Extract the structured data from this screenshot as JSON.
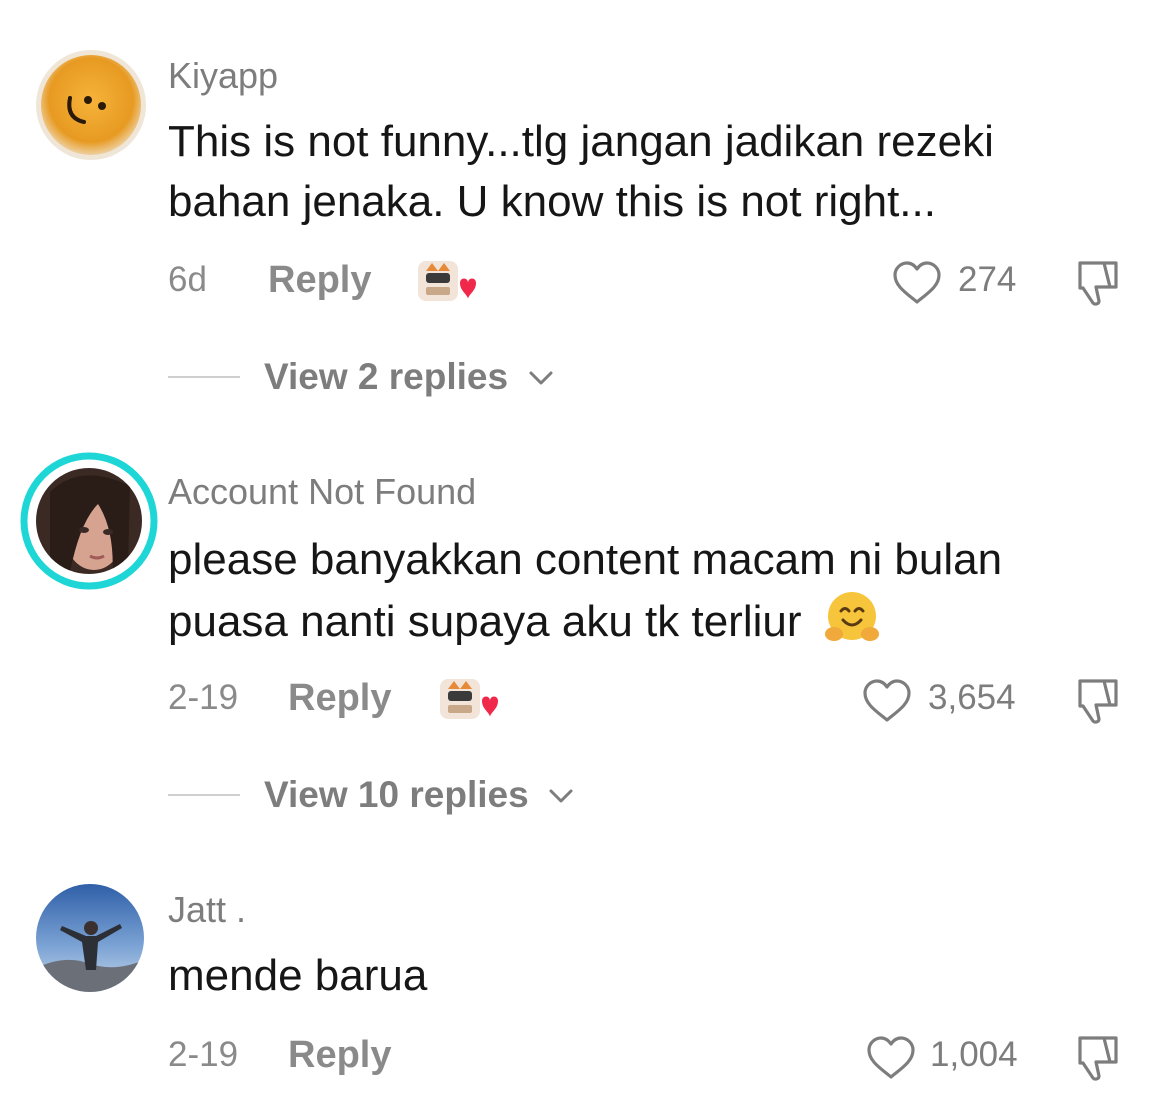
{
  "comments": [
    {
      "username": "Kiyapp",
      "text": "This is not funny...tlg jangan jadikan rezeki bahan jenaka. U know this is not right...",
      "time": "6d",
      "reply_label": "Reply",
      "likes": "274",
      "view_replies": "View 2 replies"
    },
    {
      "username": "Account Not Found",
      "text": "please banyakkan content macam ni bulan puasa nanti supaya aku tk terliur",
      "time": "2-19",
      "reply_label": "Reply",
      "likes": "3,654",
      "view_replies": "View 10 replies",
      "emoji": "hugging-face-emoji"
    },
    {
      "username": "Jatt .",
      "text": "mende barua",
      "time": "2-19",
      "reply_label": "Reply",
      "likes": "1,004"
    }
  ],
  "colors": {
    "text": "#161616",
    "muted": "#8a8a8a",
    "story_ring": "#1fd6d6",
    "heart_badge": "#f0284a"
  }
}
